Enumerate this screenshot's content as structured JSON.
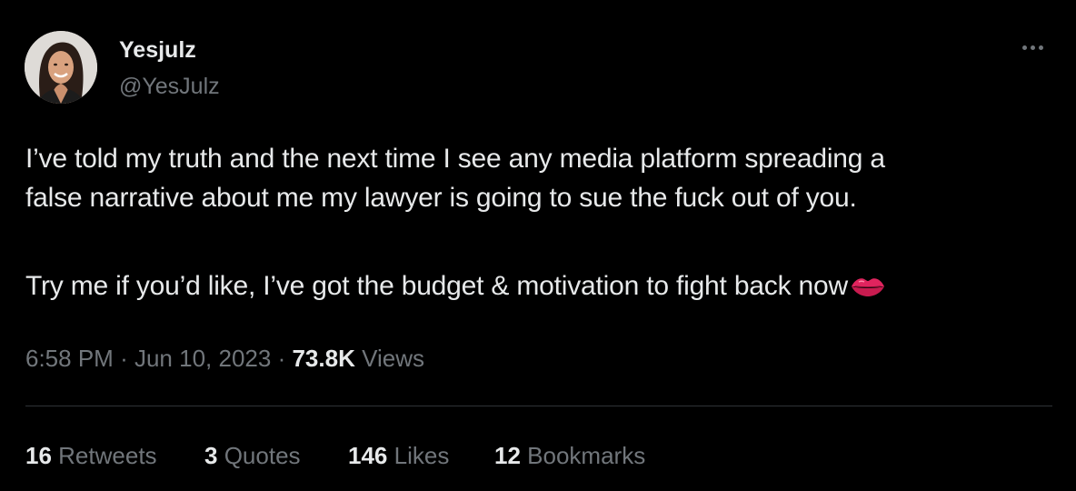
{
  "author": {
    "display_name": "Yesjulz",
    "handle": "@YesJulz"
  },
  "icons": {
    "more": "more-options-icon",
    "emoji": "kiss-mark-emoji"
  },
  "tweet": {
    "line1": "I’ve told my truth and the next time I see any media platform spreading a",
    "line2": "false narrative about me my lawyer is going to sue the fuck out of you.",
    "line3": "Try me if you’d like, I’ve got the budget & motivation to fight back now"
  },
  "meta": {
    "time": "6:58 PM",
    "separator": "·",
    "date": "Jun 10, 2023",
    "views_count": "73.8K",
    "views_label": "Views"
  },
  "stats": {
    "retweets_count": "16",
    "retweets_label": "Retweets",
    "quotes_count": "3",
    "quotes_label": "Quotes",
    "likes_count": "146",
    "likes_label": "Likes",
    "bookmarks_count": "12",
    "bookmarks_label": "Bookmarks"
  },
  "colors": {
    "background": "#000000",
    "primary_text": "#e7e9ea",
    "secondary_text": "#71767b",
    "divider": "#2f3336",
    "emoji_red": "#e0245e"
  }
}
